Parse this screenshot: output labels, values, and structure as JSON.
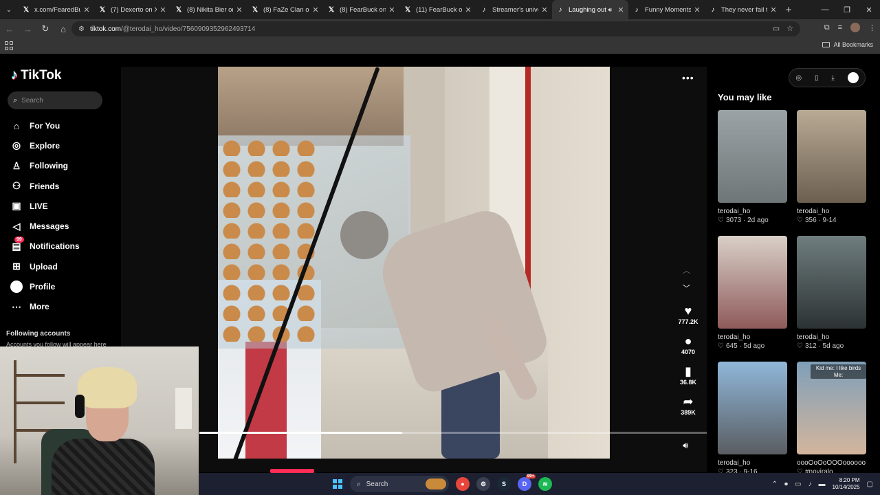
{
  "browser": {
    "tabs": [
      {
        "favicon": "x-icon",
        "title": "x.com/FearedBuck",
        "active": false
      },
      {
        "favicon": "x-icon",
        "title": "(7) Dexerto on X",
        "active": false
      },
      {
        "favicon": "x-icon",
        "title": "(8) Nikita Bier on",
        "active": false
      },
      {
        "favicon": "x-icon",
        "title": "(8) FaZe Clan on X",
        "active": false
      },
      {
        "favicon": "x-icon",
        "title": "(8) FearBuck on X",
        "active": false
      },
      {
        "favicon": "x-icon",
        "title": "(11) FearBuck on",
        "active": false
      },
      {
        "favicon": "tiktok-icon",
        "title": "Streamer's univer",
        "active": false
      },
      {
        "favicon": "tiktok-icon",
        "title": "Laughing out",
        "active": true,
        "audio": true
      },
      {
        "favicon": "tiktok-icon",
        "title": "Funny Moments",
        "active": false
      },
      {
        "favicon": "tiktok-icon",
        "title": "They never fail to",
        "active": false
      }
    ],
    "url_host": "tiktok.com",
    "url_path": "/@terodai_ho/video/7560909352962493714",
    "bookmarks_label": "All Bookmarks"
  },
  "tiktok": {
    "logo": "TikTok",
    "search_placeholder": "Search",
    "nav": [
      {
        "name": "for-you",
        "label": "For You",
        "icon": "home-icon"
      },
      {
        "name": "explore",
        "label": "Explore",
        "icon": "compass-icon"
      },
      {
        "name": "following",
        "label": "Following",
        "icon": "following-icon"
      },
      {
        "name": "friends",
        "label": "Friends",
        "icon": "friends-icon"
      },
      {
        "name": "live",
        "label": "LIVE",
        "icon": "live-icon"
      },
      {
        "name": "messages",
        "label": "Messages",
        "icon": "messages-icon"
      },
      {
        "name": "notifications",
        "label": "Notifications",
        "icon": "notifications-icon",
        "badge": "99"
      },
      {
        "name": "upload",
        "label": "Upload",
        "icon": "upload-icon"
      },
      {
        "name": "profile",
        "label": "Profile",
        "icon": "profile-icon"
      },
      {
        "name": "more",
        "label": "More",
        "icon": "more-icon"
      }
    ],
    "following_accounts_title": "Following accounts",
    "following_accounts_sub": "Accounts you follow will appear here",
    "video": {
      "likes": "777.2K",
      "comments": "4070",
      "saves": "36.8K",
      "shares": "389K",
      "progress": 0.4
    },
    "you_may_like": "You may like",
    "suggestions": [
      {
        "author": "terodai_ho",
        "likes": "3073",
        "date": "2d ago",
        "caption": ""
      },
      {
        "author": "terodai_ho",
        "likes": "356",
        "date": "9-14",
        "caption": ""
      },
      {
        "author": "terodai_ho",
        "likes": "645",
        "date": "5d ago",
        "caption": ""
      },
      {
        "author": "terodai_ho",
        "likes": "312",
        "date": "5d ago",
        "caption": ""
      },
      {
        "author": "terodai_ho",
        "likes": "323",
        "date": "9-16",
        "caption": ""
      },
      {
        "author": "oooOoOoOOOoooooo",
        "likes": "",
        "date": "#noviralo",
        "caption": "Kid me: I like birds Me:"
      }
    ]
  },
  "taskbar": {
    "search_label": "Search",
    "time": "8:20 PM",
    "date": "10/14/2025",
    "notification_count": "99+"
  }
}
